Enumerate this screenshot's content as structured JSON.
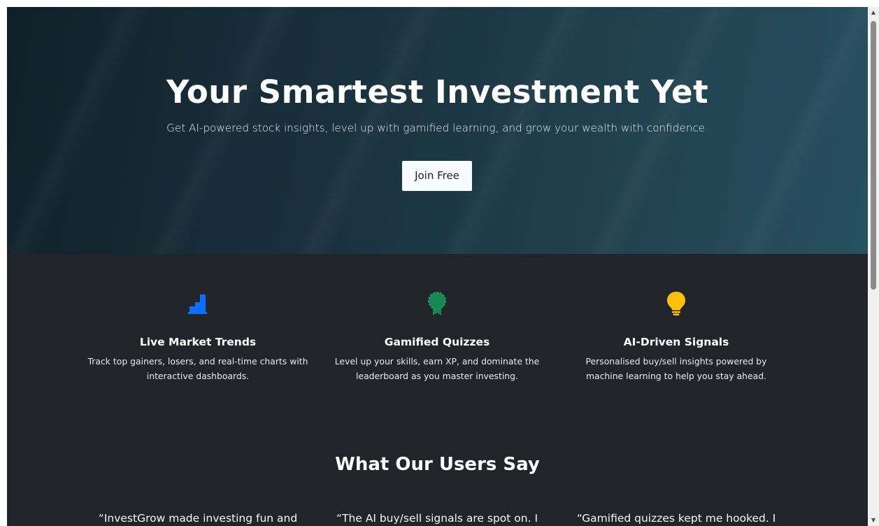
{
  "hero": {
    "title": "Your Smartest Investment Yet",
    "subtitle": "Get AI-powered stock insights, level up with gamified learning, and grow your wealth with confidence.",
    "cta_label": "Join Free"
  },
  "features": [
    {
      "icon": "bar-chart-icon",
      "icon_color": "#0d6efd",
      "title": "Live Market Trends",
      "desc_line1": "Track top gainers, losers, and real-time charts with",
      "desc_line2": "interactive dashboards."
    },
    {
      "icon": "award-icon",
      "icon_color": "#198754",
      "title": "Gamified Quizzes",
      "desc_line1": "Level up your skills, earn XP, and dominate the",
      "desc_line2": "leaderboard as you master investing."
    },
    {
      "icon": "lightbulb-icon",
      "icon_color": "#ffc107",
      "title": "AI-Driven Signals",
      "desc_line1": "Personalised buy/sell insights powered by",
      "desc_line2": "machine learning to help you stay ahead."
    }
  ],
  "testimonials": {
    "title": "What Our Users Say",
    "quotes": [
      "“InvestGrow made investing fun and",
      "“The AI buy/sell signals are spot on. I",
      "“Gamified quizzes kept me hooked. I"
    ]
  },
  "scrollbar": {
    "up_icon": "scroll-up-arrow-icon",
    "down_icon": "scroll-down-arrow-icon"
  }
}
